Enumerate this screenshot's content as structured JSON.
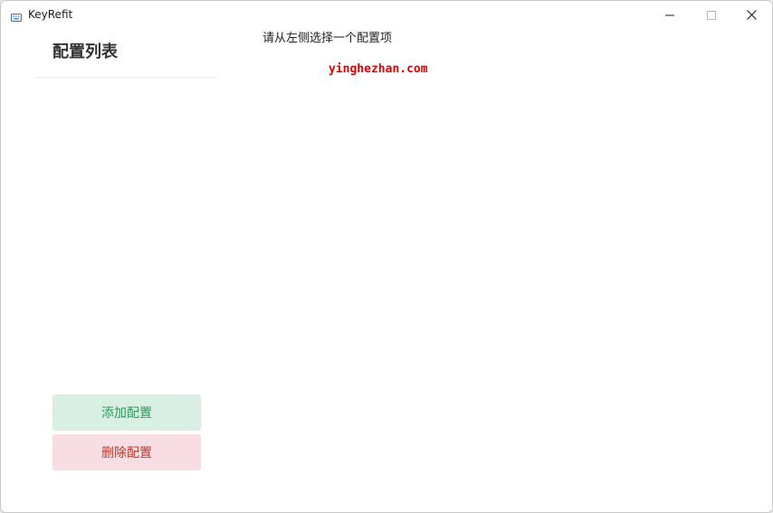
{
  "window": {
    "title": "KeyRefit",
    "app_icon": "keyboard-icon",
    "controls": {
      "minimize_icon": "minimize-icon",
      "maximize_icon": "maximize-icon",
      "close_icon": "close-icon"
    }
  },
  "sidebar": {
    "title": "配置列表",
    "items": [],
    "add_button_label": "添加配置",
    "delete_button_label": "删除配置"
  },
  "main": {
    "hint": "请从左侧选择一个配置项",
    "watermark": "yinghezhan.com"
  },
  "colors": {
    "add_button_bg": "#d9efe3",
    "add_button_text": "#2e9a5a",
    "delete_button_bg": "#f8dde2",
    "delete_button_text": "#c0392b",
    "watermark": "#e00000"
  }
}
